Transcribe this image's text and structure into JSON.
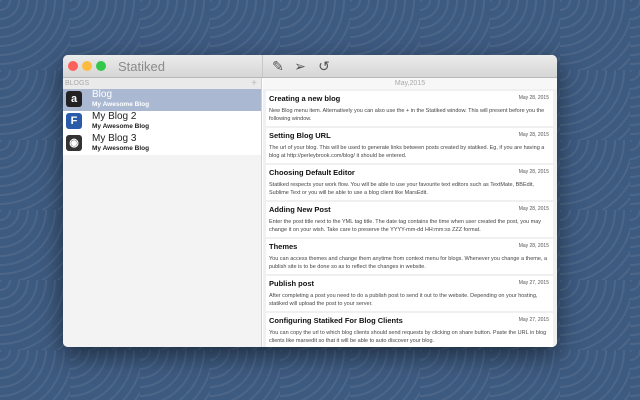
{
  "app": {
    "title": "Statiked"
  },
  "toolbar": {
    "new_post": "compose-icon",
    "publish": "send-icon",
    "refresh": "refresh-icon"
  },
  "sidebar": {
    "header": "BLOGS",
    "add": "+",
    "items": [
      {
        "name": "Blog",
        "subtitle": "My Awesome Blog",
        "icon": "amazon-icon",
        "icon_text": "a",
        "selected": true
      },
      {
        "name": "My Blog 2",
        "subtitle": "My Awesome Blog",
        "icon": "f-icon",
        "icon_text": "F"
      },
      {
        "name": "My Blog 3",
        "subtitle": "My Awesome Blog",
        "icon": "github-icon",
        "icon_text": "◉"
      }
    ]
  },
  "main": {
    "month": "May,2015",
    "posts": [
      {
        "title": "Creating a new blog",
        "date": "May 28, 2015",
        "body": " New Blog menu item. Alternatively you can also use the + in the Statiked window. This will present before you the following window."
      },
      {
        "title": "Setting Blog URL",
        "date": "May 28, 2015",
        "body": "The url of your blog. This will be used to generate links between posts created by statiked. Eg, if you are having a blog at http://perleybrook.com/blog/ it should be entered."
      },
      {
        "title": "Choosing Default Editor",
        "date": "May 28, 2015",
        "body": "Statiked respects your work flow. You will be able to use your favourite text editors such as TextMate, BBEdit, Sublime Text or you will be able to use a blog client like MarsEdit."
      },
      {
        "title": "Adding New Post",
        "date": "May 28, 2015",
        "body": "Enter the post title next to the YML tag title. The date tag contains the time when user created the post, you may change it on your wish. Take care to preserve the YYYY-mm-dd HH:mm:ss ZZZ format."
      },
      {
        "title": "Themes",
        "date": "May 28, 2015",
        "body": "You can access themes and change them anytime from context menu for blogs. Whenever you change a theme, a publish site is to be done so as to reflect the changes in website."
      },
      {
        "title": "Publish post",
        "date": "May 27, 2015",
        "body": "After completing a post you need to do a publish post to send it out to the website. Depending on your hosting, statiked will upload the post to your server."
      },
      {
        "title": "Configuring Statiked For Blog Clients",
        "date": "May 27, 2015",
        "body": "You can copy the url to which blog clients should send requests by clicking on share button. Paste the URL in blog clients like marsedit so that it will be able to auto discover your blog."
      }
    ]
  }
}
